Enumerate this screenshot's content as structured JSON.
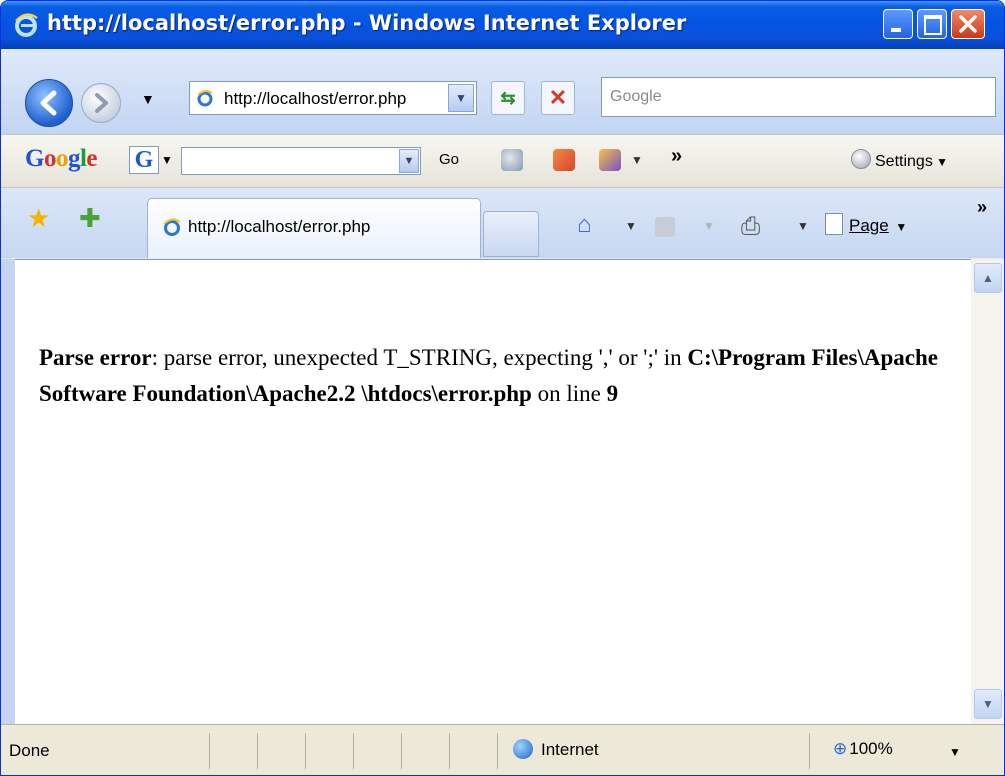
{
  "window": {
    "title": "http://localhost/error.php - Windows Internet Explorer"
  },
  "address_bar": {
    "url": "http://localhost/error.php"
  },
  "search": {
    "placeholder": "Google"
  },
  "google_toolbar": {
    "logo": [
      "G",
      "o",
      "o",
      "g",
      "l",
      "e"
    ],
    "g_button": "G",
    "go_label": "Go",
    "more_label": "»",
    "settings_label": "Settings"
  },
  "tabs": [
    {
      "label": "http://localhost/error.php",
      "active": true
    }
  ],
  "command_bar": {
    "page_label": "Page",
    "more_label": "»"
  },
  "content": {
    "error_prefix": "Parse error",
    "error_message": ": parse error, unexpected T_STRING, expecting ',' or ';' in ",
    "file_path": "C:\\Program Files\\Apache Software Foundation\\Apache2.2 \\htdocs\\error.php",
    "line_prefix": " on line ",
    "line_number": "9"
  },
  "status_bar": {
    "status": "Done",
    "zone": "Internet",
    "zoom": "100%"
  },
  "colors": {
    "titlebar": "#0455e6",
    "close_button": "#c83a17"
  },
  "icons": {
    "back": "back-arrow-icon",
    "forward": "forward-arrow-icon",
    "refresh": "refresh-icon",
    "stop": "stop-icon",
    "favorites": "star-icon",
    "add_favorite": "add-favorite-icon",
    "home": "home-icon",
    "feed": "feed-icon",
    "print": "print-icon",
    "zone": "globe-icon",
    "zoom": "magnifier-icon"
  }
}
